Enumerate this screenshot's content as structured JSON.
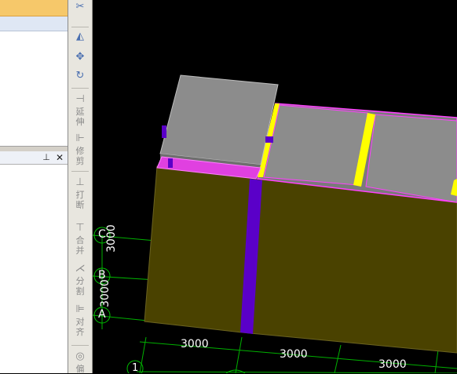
{
  "toolbar": {
    "tools": [
      {
        "name": "mirror-tool",
        "icon": "mirror",
        "label": ""
      },
      {
        "name": "move-tool",
        "icon": "move",
        "label": ""
      },
      {
        "name": "rotate-tool",
        "icon": "rotate",
        "label": ""
      },
      {
        "name": "extend-tool",
        "icon": "extend",
        "label": "延伸"
      },
      {
        "name": "trim-tool",
        "icon": "trim",
        "label": "修剪"
      },
      {
        "name": "break-tool",
        "icon": "break",
        "label": "打断"
      },
      {
        "name": "merge-tool",
        "icon": "merge",
        "label": "合并"
      },
      {
        "name": "split-tool",
        "icon": "split",
        "label": "分割"
      },
      {
        "name": "align-tool",
        "icon": "align",
        "label": "对齐"
      },
      {
        "name": "offset-tool",
        "icon": "offset",
        "label": "偏"
      }
    ]
  },
  "viewport": {
    "grid_axes": {
      "c": "C",
      "b": "B",
      "a": "A",
      "one": "1"
    },
    "dimensions": {
      "vertical_top": "3000",
      "vertical_bottom": "3000",
      "bottom_1": "3000",
      "bottom_2": "3000",
      "bottom_3": "3000"
    },
    "colors": {
      "background": "#000000",
      "wall": "#4a4200",
      "slab": "#8c8c8c",
      "column": "#5a00c8",
      "beam_highlight": "#ff40ff",
      "yellow_member": "#ffff00",
      "grid_line": "#00c000"
    }
  }
}
